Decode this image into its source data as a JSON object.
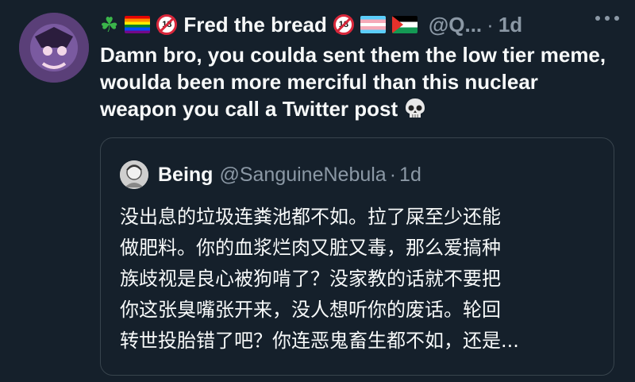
{
  "post": {
    "author_name": "Fred the bread",
    "author_handle": "@Q...",
    "separator": "·",
    "time": "1d",
    "text": "Damn bro, you coulda sent them the low tier meme, woulda been more merciful than this nuclear weapon you call a Twitter post",
    "emojis": [
      "shamrock",
      "rainbow-flag",
      "no-under-18",
      "no-under-18",
      "transgender-flag",
      "palestine-flag",
      "skull"
    ]
  },
  "quote": {
    "author_name": "Being",
    "author_handle": "@SanguineNebula",
    "separator": "·",
    "time": "1d",
    "text": "没出息的垃圾连粪池都不如。拉了屎至少还能\n做肥料。你的血浆烂肉又脏又毒，那么爱搞种\n族歧视是良心被狗啃了？没家教的话就不要把\n你这张臭嘴张开来，没人想听你的废话。轮回\n转世投胎错了吧？你连恶鬼畜生都不如，还是..."
  },
  "colors": {
    "background": "#15202b",
    "text": "#f7f9f9",
    "muted": "#8b98a5",
    "border": "#38444d"
  }
}
